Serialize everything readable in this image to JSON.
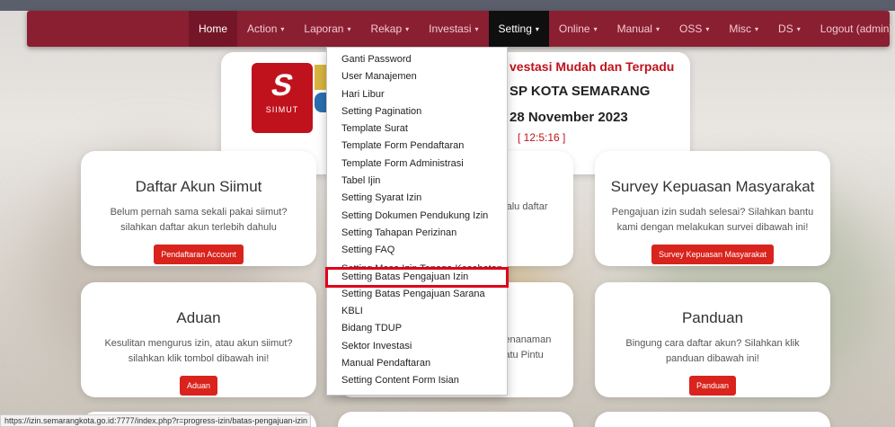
{
  "nav": {
    "items": [
      {
        "label": "Home",
        "caret": false
      },
      {
        "label": "Action",
        "caret": true
      },
      {
        "label": "Laporan",
        "caret": true
      },
      {
        "label": "Rekap",
        "caret": true
      },
      {
        "label": "Investasi",
        "caret": true
      },
      {
        "label": "Setting",
        "caret": true
      },
      {
        "label": "Online",
        "caret": true
      },
      {
        "label": "Manual",
        "caret": true
      },
      {
        "label": "OSS",
        "caret": true
      },
      {
        "label": "Misc",
        "caret": true
      },
      {
        "label": "DS",
        "caret": true
      },
      {
        "label": "Logout (admin)",
        "caret": false
      }
    ],
    "caret_glyph": "▾"
  },
  "dropdown": {
    "items": [
      "Ganti Password",
      "User Manajemen",
      "Hari Libur",
      "Setting Pagination",
      "Template Surat",
      "Template Form Pendaftaran",
      "Template Form Administrasi",
      "Tabel Ijin",
      "Setting Syarat Izin",
      "Setting Dokumen Pendukung Izin",
      "Setting Tahapan Perizinan",
      "Setting FAQ",
      "Setting Masa Izin Tenaga Kesehatan",
      "Setting Batas Pengajuan Izin",
      "Setting Batas Pengajuan Sarana",
      "KBLI",
      "Bidang TDUP",
      "Sektor Investasi",
      "Manual Pendaftaran",
      "Setting Content Form Isian"
    ]
  },
  "hero": {
    "logo_word": "SIIMUT",
    "line1": "vestasi Mudah dan Terpadu",
    "line2": "SP KOTA SEMARANG",
    "line3": "28 November 2023",
    "clock": "[ 12:5:16 ]"
  },
  "cards": {
    "daftar": {
      "title": "Daftar Akun Siimut",
      "text1": "Belum pernah sama sekali pakai siimut?",
      "text2": "silahkan daftar akun terlebih dahulu",
      "button": "Pendaftaran Account"
    },
    "survey": {
      "title": "Survey Kepuasan Masyarakat",
      "text1": "Pengajuan izin sudah selesai? Silahkan bantu",
      "text2": "kami dengan melakukan survei dibawah ini!",
      "button": "Survey Kepuasan Masyarakat"
    },
    "middle1": {
      "text": "n lalu daftar"
    },
    "aduan": {
      "title": "Aduan",
      "text1": "Kesulitan mengurus izin, atau akun siimut?",
      "text2": "silahkan klik tombol dibawah ini!",
      "button": "Aduan"
    },
    "middle2": {
      "text1": "Penanaman",
      "text2": "Satu Pintu"
    },
    "panduan": {
      "title": "Panduan",
      "text1": "Bingung cara daftar akun? Silahkan klik",
      "text2": "panduan dibawah ini!",
      "button": "Panduan"
    }
  },
  "status_url": "https://izin.semarangkota.go.id:7777/index.php?r=progress-izin/batas-pengajuan-izin"
}
